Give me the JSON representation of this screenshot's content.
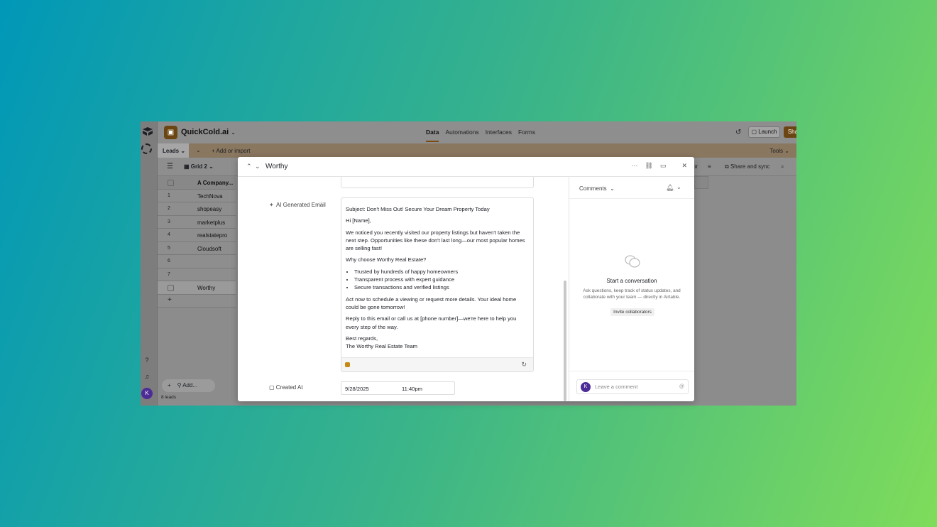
{
  "app": {
    "base_name": "QuickCold.ai",
    "nav": [
      "Data",
      "Automations",
      "Interfaces",
      "Forms"
    ],
    "launch_label": "Launch",
    "share_label": "Share"
  },
  "tabsbar": {
    "table_name": "Leads",
    "add_import": "Add or import",
    "tools": "Tools"
  },
  "viewbar": {
    "view_name": "Grid 2",
    "partial_label": "or",
    "share_sync": "Share and sync"
  },
  "grid": {
    "header": "Company...",
    "rows": [
      {
        "num": "1",
        "company": "TechNova"
      },
      {
        "num": "2",
        "company": "shopeasy"
      },
      {
        "num": "3",
        "company": "marketplus"
      },
      {
        "num": "4",
        "company": "realstatepro"
      },
      {
        "num": "5",
        "company": "Cloudsoft"
      },
      {
        "num": "6",
        "company": ""
      },
      {
        "num": "7",
        "company": ""
      },
      {
        "num": "",
        "company": "Worthy"
      }
    ],
    "add_label": "Add...",
    "count": "8 leads"
  },
  "modal": {
    "title": "Worthy",
    "field_label": "AI Generated Email",
    "email": {
      "subject": "Subject: Don't Miss Out! Secure Your Dream Property Today",
      "greeting": "Hi [Name],",
      "p1": "We noticed you recently visited our property listings but haven't taken the next step. Opportunities like these don't last long—our most popular homes are selling fast!",
      "why": "Why choose Worthy Real Estate?",
      "bullets": [
        "Trusted by hundreds of happy homeowners",
        "Transparent process with expert guidance",
        "Secure transactions and verified listings"
      ],
      "p2": "Act now to schedule a viewing or request more details. Your ideal home could be gone tomorrow!",
      "p3": "Reply to this email or call us at [phone number]—we're here to help you every step of the way.",
      "closing": "Best regards,",
      "signature": "The Worthy Real Estate Team"
    },
    "created_label": "Created At",
    "created_date": "9/28/2025",
    "created_time": "11:40pm"
  },
  "comments": {
    "title": "Comments",
    "start_title": "Start a conversation",
    "start_desc": "Ask questions, keep track of status updates, and collaborate with your team — directly in Airtable.",
    "invite": "Invite collaborators",
    "placeholder": "Leave a comment",
    "avatar": "K"
  },
  "user_avatar": "K"
}
